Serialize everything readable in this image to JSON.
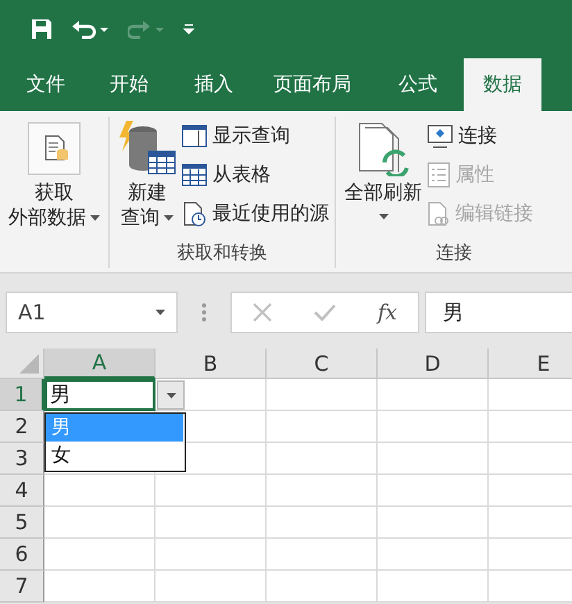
{
  "tabs": [
    {
      "label": "文件",
      "selected": false
    },
    {
      "label": "开始",
      "selected": false
    },
    {
      "label": "插入",
      "selected": false
    },
    {
      "label": "页面布局",
      "selected": false
    },
    {
      "label": "公式",
      "selected": false
    },
    {
      "label": "数据",
      "selected": true
    }
  ],
  "ribbon": {
    "groups": [
      {
        "buttons": [
          {
            "kind": "large",
            "lines": [
              "获取",
              "外部数据"
            ],
            "has_menu": true,
            "disabled": false
          }
        ]
      },
      {
        "label": "获取和转换",
        "buttons": [
          {
            "kind": "large",
            "lines": [
              "新建",
              "查询"
            ],
            "has_menu": true,
            "disabled": false
          },
          {
            "kind": "small",
            "lines": [
              "显示查询"
            ],
            "has_menu": false,
            "disabled": false
          },
          {
            "kind": "small",
            "lines": [
              "从表格"
            ],
            "has_menu": false,
            "disabled": false
          },
          {
            "kind": "small",
            "lines": [
              "最近使用的源"
            ],
            "has_menu": false,
            "disabled": false
          }
        ]
      },
      {
        "label": "连接",
        "buttons": [
          {
            "kind": "large",
            "lines": [
              "全部刷新"
            ],
            "has_menu": true,
            "disabled": false
          },
          {
            "kind": "small",
            "lines": [
              "连接"
            ],
            "has_menu": false,
            "disabled": false
          },
          {
            "kind": "small",
            "lines": [
              "属性"
            ],
            "has_menu": false,
            "disabled": true
          },
          {
            "kind": "small",
            "lines": [
              "编辑链接"
            ],
            "has_menu": false,
            "disabled": true
          }
        ]
      }
    ]
  },
  "formula_bar": {
    "name_box": "A1",
    "function_label": "fx",
    "value": "男"
  },
  "sheet": {
    "columns": [
      {
        "label": "A",
        "selected": true
      },
      {
        "label": "B",
        "selected": false
      },
      {
        "label": "C",
        "selected": false
      },
      {
        "label": "D",
        "selected": false
      },
      {
        "label": "E",
        "selected": false
      }
    ],
    "rows": [
      {
        "label": "1",
        "selected": true
      },
      {
        "label": "2",
        "selected": false
      },
      {
        "label": "3",
        "selected": false
      },
      {
        "label": "4",
        "selected": false
      },
      {
        "label": "5",
        "selected": false
      },
      {
        "label": "6",
        "selected": false
      },
      {
        "label": "7",
        "selected": false
      }
    ],
    "active_cell_value": "男",
    "validation_list": [
      {
        "label": "男",
        "selected": true
      },
      {
        "label": "女",
        "selected": false
      }
    ]
  }
}
